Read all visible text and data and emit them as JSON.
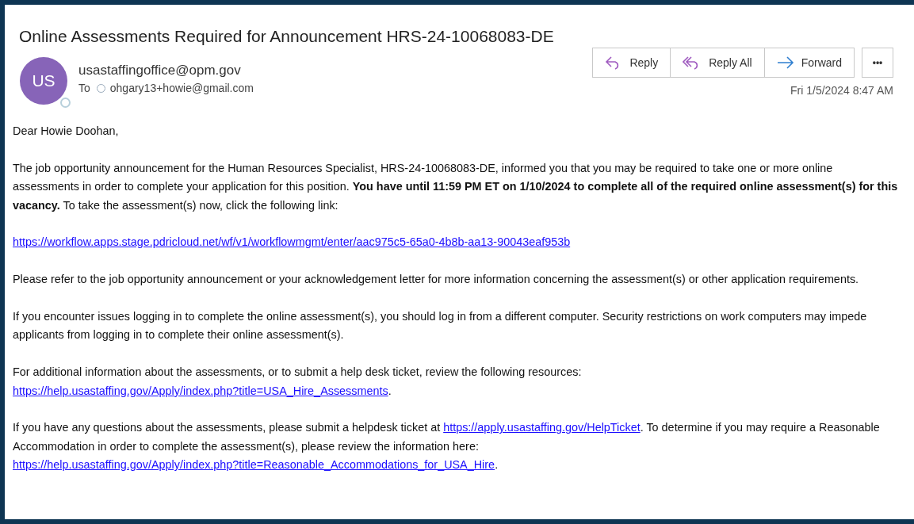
{
  "subject": "Online Assessments Required for Announcement HRS-24-10068083-DE",
  "sender": {
    "initials": "US",
    "email": "usastaffingoffice@opm.gov",
    "to_label": "To",
    "recipient": "ohgary13+howie@gmail.com"
  },
  "actions": [
    {
      "kind": "reply",
      "label": "Reply"
    },
    {
      "kind": "reply_all",
      "label": "Reply All"
    },
    {
      "kind": "forward",
      "label": "Forward"
    },
    {
      "kind": "more",
      "label": "•••"
    }
  ],
  "date": "Fri 1/5/2024 8:47 AM",
  "body": [
    {
      "segments": [
        {
          "kind": "text",
          "text": "Dear Howie Doohan,"
        }
      ]
    },
    {
      "segments": [
        {
          "kind": "text",
          "text": "The job opportunity announcement for the Human Resources Specialist, HRS-24-10068083-DE, informed you that you may be required to take one or more online assessments in order to complete your application for this position. **You have until 11:59 PM ET on 1/10/2024 to complete all of the required online assessment(s) for this vacancy.** To take the assessment(s) now, click the following link:"
        }
      ]
    },
    {
      "segments": [
        {
          "kind": "link",
          "text": "https://workflow.apps.stage.pdricloud.net/wf/v1/workflowmgmt/enter/aac975c5-65a0-4b8b-aa13-90043eaf953b"
        }
      ]
    },
    {
      "segments": [
        {
          "kind": "text",
          "text": "Please refer to the job opportunity announcement or your acknowledgement letter for more information concerning the assessment(s) or other application requirements."
        }
      ]
    },
    {
      "segments": [
        {
          "kind": "text",
          "text": "If you encounter issues logging in to complete the online assessment(s), you should log in from a different computer. Security restrictions on work computers may impede applicants from logging in to complete their online assessment(s)."
        }
      ]
    },
    {
      "segments": [
        {
          "kind": "text",
          "text": "For additional information about the assessments, or to submit a help desk ticket, review the following resources: "
        },
        {
          "kind": "link",
          "text": "https://help.usastaffing.gov/Apply/index.php?title=USA_Hire_Assessments"
        },
        {
          "kind": "text",
          "text": "."
        }
      ]
    },
    {
      "segments": [
        {
          "kind": "text",
          "text": "If you have any questions about the assessments, please submit a helpdesk ticket at "
        },
        {
          "kind": "link",
          "text": "https://apply.usastaffing.gov/HelpTicket"
        },
        {
          "kind": "text",
          "text": ". To determine if you may require a Reasonable Accommodation in order to complete the assessment(s), please review the information here: "
        },
        {
          "kind": "link",
          "text": "https://help.usastaffing.gov/Apply/index.php?title=Reasonable_Accommodations_for_USA_Hire"
        },
        {
          "kind": "text",
          "text": "."
        }
      ]
    }
  ]
}
